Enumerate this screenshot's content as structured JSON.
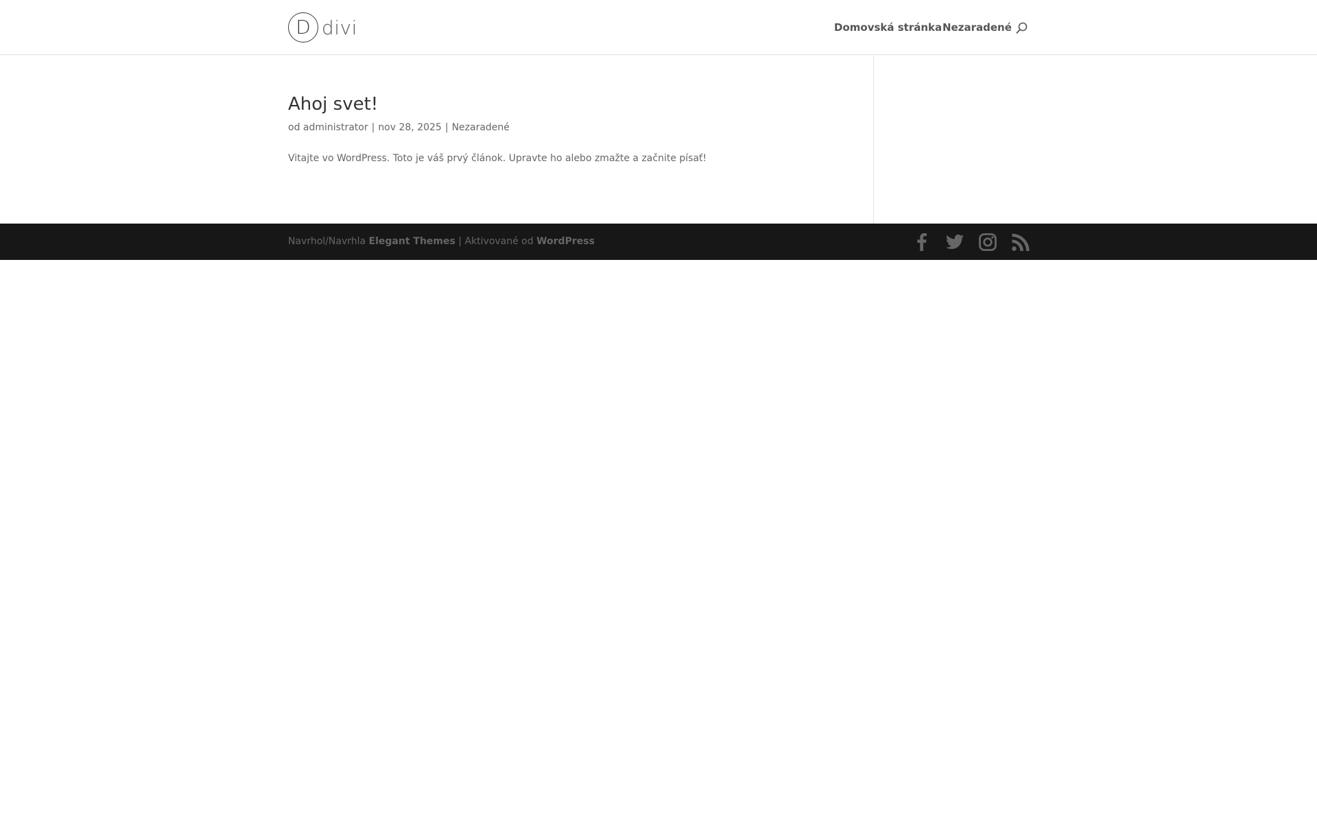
{
  "header": {
    "logo": {
      "mark": "D",
      "word": "divi"
    },
    "nav": [
      {
        "label": "Domovská stránka"
      },
      {
        "label": "Nezaradené"
      }
    ],
    "search_icon": "search-icon"
  },
  "post": {
    "title": "Ahoj svet!",
    "meta": {
      "by_prefix": "od",
      "author": "administrator",
      "separator": "|",
      "date": "nov 28, 2025",
      "category": "Nezaradené"
    },
    "excerpt": "Vitajte vo WordPress. Toto je váš prvý článok. Upravte ho alebo zmažte a začnite písať!"
  },
  "footer": {
    "credits": {
      "designed_by": "Navrhol/Navrhla",
      "theme_link": "Elegant Themes",
      "separator": "|",
      "powered_by": "Aktivované od",
      "wp_link": "WordPress"
    },
    "social": [
      "facebook-icon",
      "twitter-icon",
      "instagram-icon",
      "rss-icon"
    ]
  },
  "colors": {
    "text": "#666666",
    "title": "#333333",
    "nav_text": "#555555",
    "footer_bg": "#171717",
    "social_icon": "#666666",
    "divider": "#e2e2e2"
  }
}
